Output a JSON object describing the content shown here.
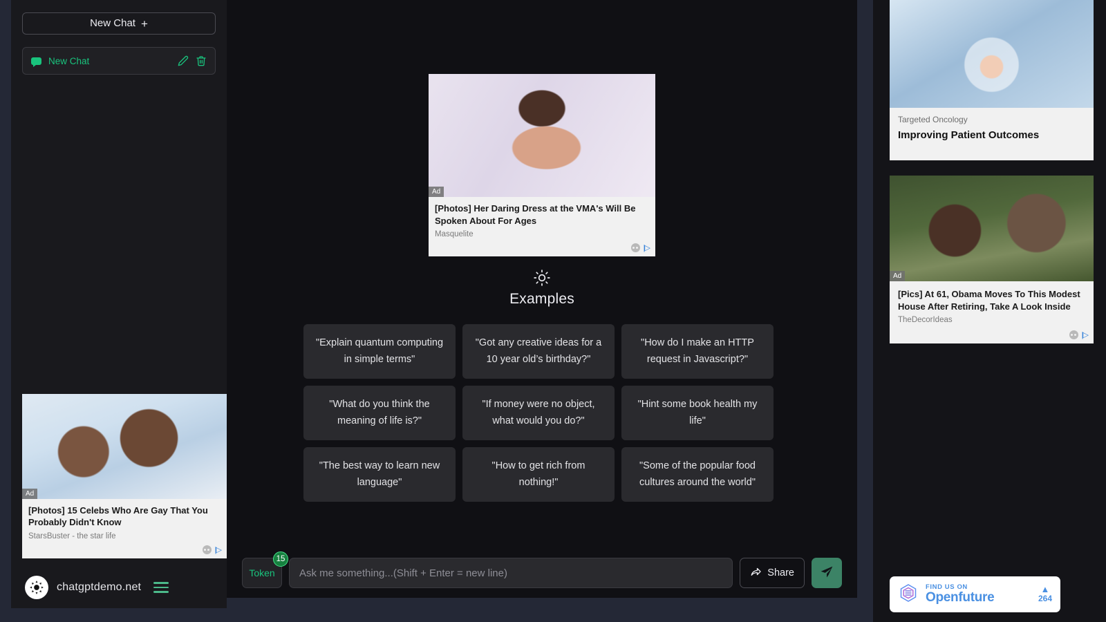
{
  "sidebar": {
    "new_chat_button": "New Chat",
    "new_chat_plus": "+",
    "chats": [
      {
        "label": "New Chat",
        "icon": "chat-bubble-icon",
        "edit_icon": "pencil-icon",
        "delete_icon": "trash-icon"
      }
    ],
    "ad": {
      "badge": "Ad",
      "title": "[Photos] 15 Celebs Who Are Gay That You Probably Didn't Know",
      "source": "StarsBuster - the star life",
      "adchoices": "|▷"
    },
    "brand": {
      "name": "chatgptdemo.net",
      "logo_icon": "sun-logo-icon",
      "menu_icon": "hamburger-icon"
    }
  },
  "main": {
    "ad": {
      "badge": "Ad",
      "title": "[Photos] Her Daring Dress at the VMA's Will Be Spoken About For Ages",
      "source": "Masquelite",
      "adchoices": "|▷"
    },
    "examples_heading": "Examples",
    "examples_icon": "sun-icon",
    "examples": [
      "\"Explain quantum computing in simple terms\"",
      "\"Got any creative ideas for a 10 year old’s birthday?\"",
      "\"How do I make an HTTP request in Javascript?\"",
      "\"What do you think the meaning of life is?\"",
      "\"If money were no object, what would you do?\"",
      "\"Hint some book health my life\"",
      "\"The best way to learn new language\"",
      "\"How to get rich from nothing!\"",
      "\"Some of the popular food cultures around the world\""
    ],
    "composer": {
      "token_label": "Token",
      "token_count": "15",
      "input_placeholder": "Ask me something...(Shift + Enter = new line)",
      "input_value": "",
      "share_label": "Share",
      "share_icon": "share-arrow-icon",
      "send_icon": "paper-plane-icon"
    }
  },
  "right_rail": {
    "ads": [
      {
        "corner": "▷",
        "label": "Targeted Oncology",
        "headline": "Improving Patient Outcomes"
      },
      {
        "badge": "Ad",
        "title": "[Pics] At 61, Obama Moves To This Modest House After Retiring, Take A Look Inside",
        "source": "TheDecorIdeas",
        "adchoices": "|▷"
      }
    ],
    "openfuture": {
      "find_us_on": "FIND US ON",
      "name": "Openfuture",
      "triangle": "▲",
      "count": "264"
    }
  },
  "colors": {
    "accent_green": "#19c37d",
    "send_button": "#3c8366",
    "page_bg": "#242836",
    "sidebar_bg": "#19191d",
    "main_bg": "#101014",
    "card_bg": "#2a2a2e",
    "openfuture_blue": "#4a90e2"
  }
}
